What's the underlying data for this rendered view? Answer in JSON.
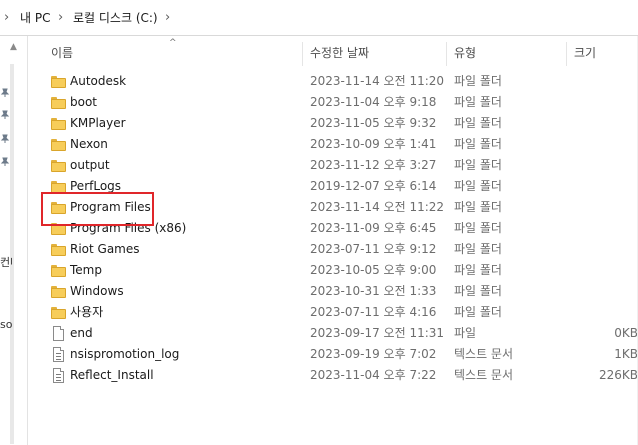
{
  "breadcrumb": {
    "sep": "›",
    "items": [
      "내 PC",
      "로컬 디스크 (C:)"
    ]
  },
  "nav": {
    "scroll_up": "▲",
    "partial_labels": [
      "컨나",
      "sol"
    ]
  },
  "columns": {
    "sort_indicator": "^",
    "name": "이름",
    "date": "수정한 날짜",
    "type": "유형",
    "size": "크기"
  },
  "files": [
    {
      "name": "Autodesk",
      "date": "2023-11-14 오전 11:20",
      "type": "파일 폴더",
      "size": "",
      "icon": "folder-icon"
    },
    {
      "name": "boot",
      "date": "2023-11-04 오후 9:18",
      "type": "파일 폴더",
      "size": "",
      "icon": "folder-icon"
    },
    {
      "name": "KMPlayer",
      "date": "2023-11-05 오후 9:32",
      "type": "파일 폴더",
      "size": "",
      "icon": "folder-icon"
    },
    {
      "name": "Nexon",
      "date": "2023-10-09 오후 1:41",
      "type": "파일 폴더",
      "size": "",
      "icon": "folder-icon"
    },
    {
      "name": "output",
      "date": "2023-11-12 오후 3:27",
      "type": "파일 폴더",
      "size": "",
      "icon": "folder-icon"
    },
    {
      "name": "PerfLogs",
      "date": "2019-12-07 오후 6:14",
      "type": "파일 폴더",
      "size": "",
      "icon": "folder-icon"
    },
    {
      "name": "Program Files",
      "date": "2023-11-14 오전 11:22",
      "type": "파일 폴더",
      "size": "",
      "icon": "folder-icon"
    },
    {
      "name": "Program Files (x86)",
      "date": "2023-11-09 오후 6:45",
      "type": "파일 폴더",
      "size": "",
      "icon": "folder-icon"
    },
    {
      "name": "Riot Games",
      "date": "2023-07-11 오후 9:12",
      "type": "파일 폴더",
      "size": "",
      "icon": "folder-icon"
    },
    {
      "name": "Temp",
      "date": "2023-10-05 오후 9:00",
      "type": "파일 폴더",
      "size": "",
      "icon": "folder-icon"
    },
    {
      "name": "Windows",
      "date": "2023-10-31 오전 1:33",
      "type": "파일 폴더",
      "size": "",
      "icon": "folder-icon"
    },
    {
      "name": "사용자",
      "date": "2023-07-11 오후 4:16",
      "type": "파일 폴더",
      "size": "",
      "icon": "folder-icon"
    },
    {
      "name": "end",
      "date": "2023-09-17 오전 11:31",
      "type": "파일",
      "size": "0KB",
      "icon": "file-icon"
    },
    {
      "name": "nsispromotion_log",
      "date": "2023-09-19 오후 7:02",
      "type": "텍스트 문서",
      "size": "1KB",
      "icon": "text-file-icon"
    },
    {
      "name": "Reflect_Install",
      "date": "2023-11-04 오후 7:22",
      "type": "텍스트 문서",
      "size": "226KB",
      "icon": "text-file-icon"
    }
  ],
  "colors": {
    "highlight": "#e0262a",
    "folder": "#f7cd5a"
  }
}
